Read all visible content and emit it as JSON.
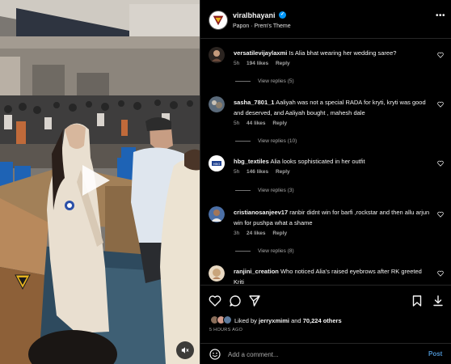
{
  "post": {
    "author": "viralbhayani",
    "audio": "Papon · Prem's Theme",
    "verified_icon": "verified-badge-icon",
    "more_icon": "more-options-icon"
  },
  "comments": [
    {
      "user": "versatilevijaylaxmi",
      "text": "Is Alia bhat wearing her wedding saree?",
      "time": "5h",
      "likes": "194 likes",
      "reply": "Reply",
      "view_replies": "View replies (5)"
    },
    {
      "user": "sasha_7801_1",
      "text": "Aaliyah was not a special RADA for kryti, kryti was good and deserved, and Aaliyah bought , mahesh dale",
      "time": "5h",
      "likes": "44 likes",
      "reply": "Reply",
      "view_replies": "View replies (10)"
    },
    {
      "user": "hbg_textiles",
      "text": "Alia looks sophisticated in her outfit",
      "time": "5h",
      "likes": "146 likes",
      "reply": "Reply",
      "view_replies": "View replies (3)"
    },
    {
      "user": "cristianosanjeev17",
      "text": "ranbir didnt win for barfi ,rockstar and then allu arjun win for pushpa what a shame",
      "time": "3h",
      "likes": "24 likes",
      "reply": "Reply",
      "view_replies": "View replies (8)"
    },
    {
      "user": "ranjini_creation",
      "text": "Who noticed Alia's raised eyebrows after RK greeted Kriti"
    }
  ],
  "actions": {
    "liked_prefix": "Liked by",
    "liked_user": "jerryxmimi",
    "liked_and": "and",
    "liked_count": "70,224 others",
    "timestamp": "5 HOURS AGO"
  },
  "add_comment": {
    "placeholder": "Add a comment...",
    "post_label": "Post"
  },
  "colors": {
    "background": "#000000",
    "text": "#f5f5f5",
    "secondary_text": "#a8a8a8",
    "accent": "#0095f6",
    "post_button": "#4a8ec9"
  }
}
